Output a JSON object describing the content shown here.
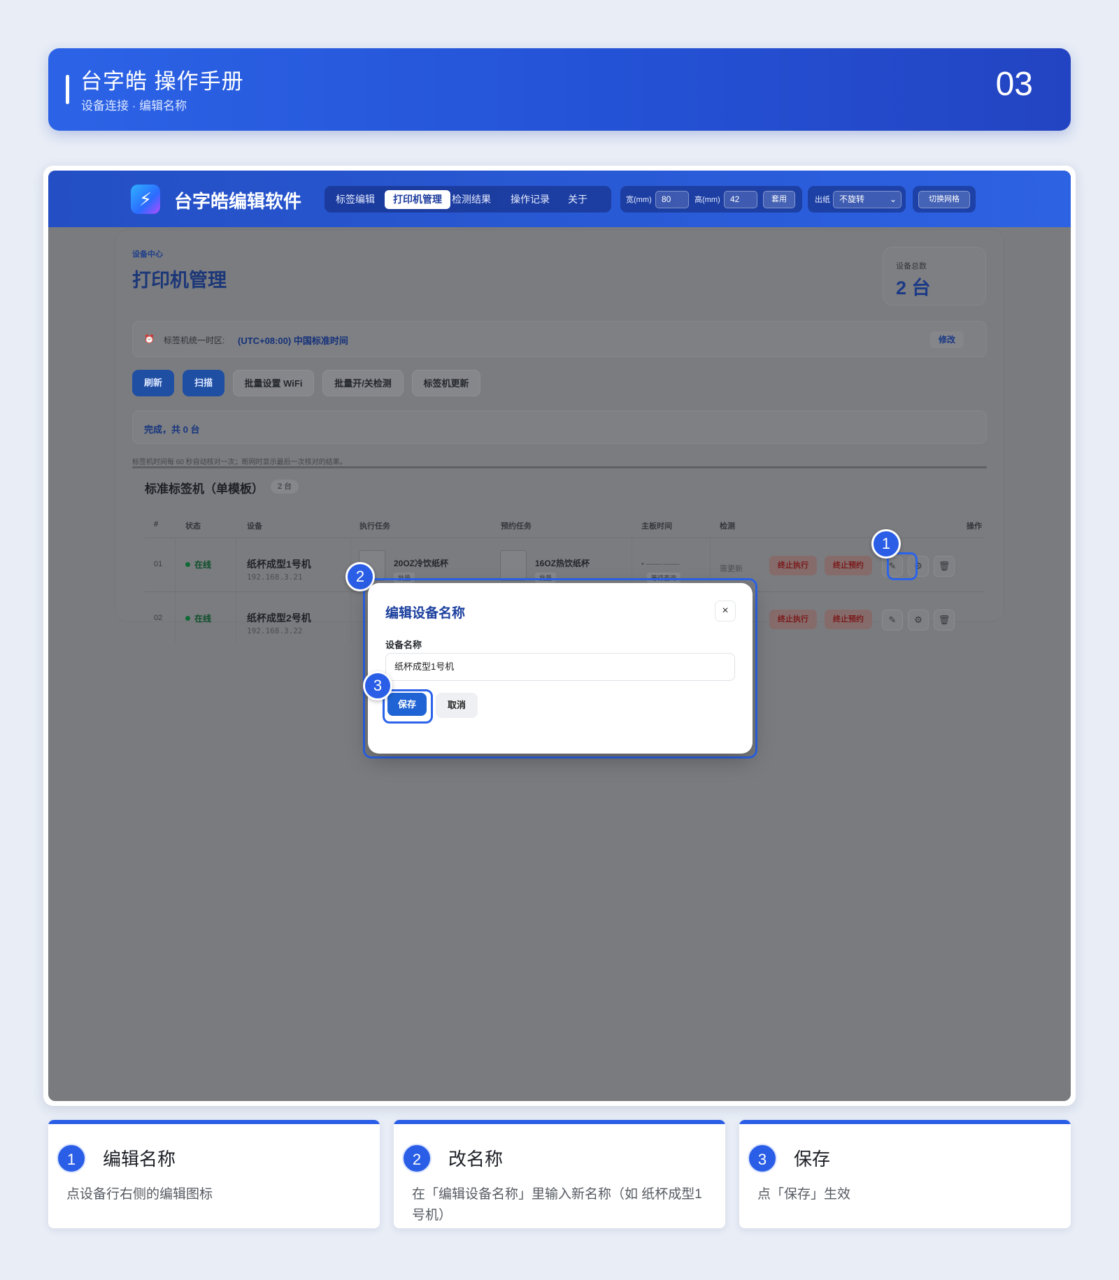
{
  "banner": {
    "title": "台字皓 操作手册",
    "subtitle": "设备连接 · 编辑名称",
    "page_number": "03"
  },
  "app": {
    "name": "台字皓编辑软件",
    "logo_icon": "lightning-bolt-icon",
    "nav": [
      "标签编辑",
      "打印机管理",
      "检测结果",
      "操作记录",
      "关于"
    ],
    "nav_active": "打印机管理",
    "size_controls": {
      "width_label": "宽(mm)",
      "width_value": "80",
      "height_label": "高(mm)",
      "height_value": "42",
      "apply_label": "套用"
    },
    "paper_out": {
      "label": "出纸",
      "value": "不旋转"
    },
    "grid_toggle_label": "切换网格"
  },
  "page": {
    "eyebrow": "设备中心",
    "title": "打印机管理",
    "count_label": "设备总数",
    "count_value": "2 台",
    "timezone": {
      "label": "标签机统一时区:",
      "value": "(UTC+08:00) 中国标准时间",
      "edit_label": "修改"
    },
    "actions": [
      "刷新",
      "扫描",
      "批量设置 WiFi",
      "批量开/关检测",
      "标签机更新"
    ],
    "status_text": "完成，共 0 台",
    "note": "标签机时间每 60 秒自动核对一次；断网时显示最后一次核对的结果。",
    "section": {
      "title": "标准标签机（单模板）",
      "badge": "2 台"
    },
    "table": {
      "headers": [
        "#",
        "状态",
        "设备",
        "执行任务",
        "预约任务",
        "主板时间",
        "检测",
        "操作"
      ],
      "rows": [
        {
          "index": "01",
          "status": "在线",
          "device": "纸杯成型1号机",
          "ip": "192.168.3.21",
          "exec_task": "20OZ冷饮纸杯",
          "exec_tag": "批量",
          "reserve_task": "16OZ热饮纸杯",
          "reserve_tag": "批量",
          "board_time_tag": "等待查询",
          "detect": "需更新",
          "stop_exec": "终止执行",
          "stop_reserve": "终止预约"
        },
        {
          "index": "02",
          "status": "在线",
          "device": "纸杯成型2号机",
          "ip": "192.168.3.22",
          "stop_exec": "终止执行",
          "stop_reserve": "终止预约"
        }
      ]
    }
  },
  "modal": {
    "title": "编辑设备名称",
    "close_symbol": "×",
    "field_label": "设备名称",
    "field_value": "纸杯成型1号机",
    "save_label": "保存",
    "cancel_label": "取消"
  },
  "callouts": [
    "1",
    "2",
    "3"
  ],
  "steps": [
    {
      "number": "1",
      "title": "编辑名称",
      "desc": "点设备行右侧的编辑图标"
    },
    {
      "number": "2",
      "title": "改名称",
      "desc": "在「编辑设备名称」里输入新名称（如 纸杯成型1号机）"
    },
    {
      "number": "3",
      "title": "保存",
      "desc": "点「保存」生效"
    }
  ],
  "colors": {
    "accent": "#2a5ee6",
    "banner": "#2452d6",
    "overlay": "#7a7b7e",
    "online": "#0f6b36",
    "danger": "#7a1b1b"
  }
}
